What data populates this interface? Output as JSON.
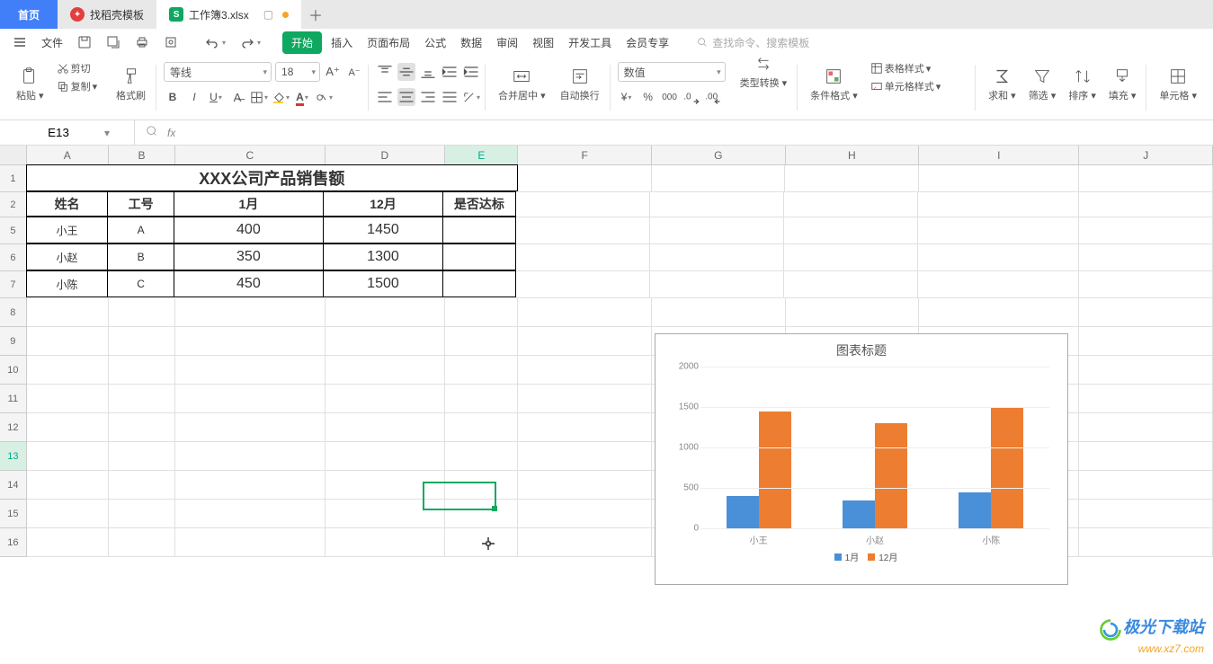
{
  "tabs": {
    "home": "首页",
    "template": "找稻壳模板",
    "active": "工作簿3.xlsx"
  },
  "quickbar": {
    "file": "文件"
  },
  "menus": {
    "start": "开始",
    "insert": "插入",
    "layout": "页面布局",
    "formula": "公式",
    "data": "数据",
    "review": "审阅",
    "view": "视图",
    "devtools": "开发工具",
    "member": "会员专享"
  },
  "search_placeholder": "查找命令、搜索模板",
  "ribbon": {
    "paste": "粘贴",
    "cut": "剪切",
    "copy": "复制",
    "format_painter": "格式刷",
    "font_name": "等线",
    "font_size": "18",
    "merge": "合并居中",
    "wrap": "自动换行",
    "number_format": "数值",
    "type_convert": "类型转换",
    "cond_format": "条件格式",
    "table_style": "表格样式",
    "cell_style": "单元格样式",
    "sum": "求和",
    "filter": "筛选",
    "sort": "排序",
    "fill": "填充",
    "cell": "单元格"
  },
  "name_box": "E13",
  "columns": [
    "A",
    "B",
    "C",
    "D",
    "E",
    "F",
    "G",
    "H",
    "I",
    "J"
  ],
  "row_nums": [
    "1",
    "2",
    "5",
    "6",
    "7",
    "8",
    "9",
    "10",
    "11",
    "12",
    "13",
    "14",
    "15",
    "16"
  ],
  "table": {
    "title": "XXX公司产品销售额",
    "headers": {
      "name": "姓名",
      "id": "工号",
      "m1": "1月",
      "m12": "12月",
      "ok": "是否达标"
    },
    "rows": [
      {
        "name": "小王",
        "id": "A",
        "m1": "400",
        "m12": "1450"
      },
      {
        "name": "小赵",
        "id": "B",
        "m1": "350",
        "m12": "1300"
      },
      {
        "name": "小陈",
        "id": "C",
        "m1": "450",
        "m12": "1500"
      }
    ]
  },
  "chart_data": {
    "type": "bar",
    "title": "图表标题",
    "categories": [
      "小王",
      "小赵",
      "小陈"
    ],
    "series": [
      {
        "name": "1月",
        "values": [
          400,
          350,
          450
        ],
        "color": "#4a90d9"
      },
      {
        "name": "12月",
        "values": [
          1450,
          1300,
          1500
        ],
        "color": "#ed7d31"
      }
    ],
    "ylim": [
      0,
      2000
    ],
    "ystep": 500,
    "xlabel": "",
    "ylabel": ""
  },
  "watermark": {
    "line1": "极光下载站",
    "line2": "www.xz7.com"
  }
}
